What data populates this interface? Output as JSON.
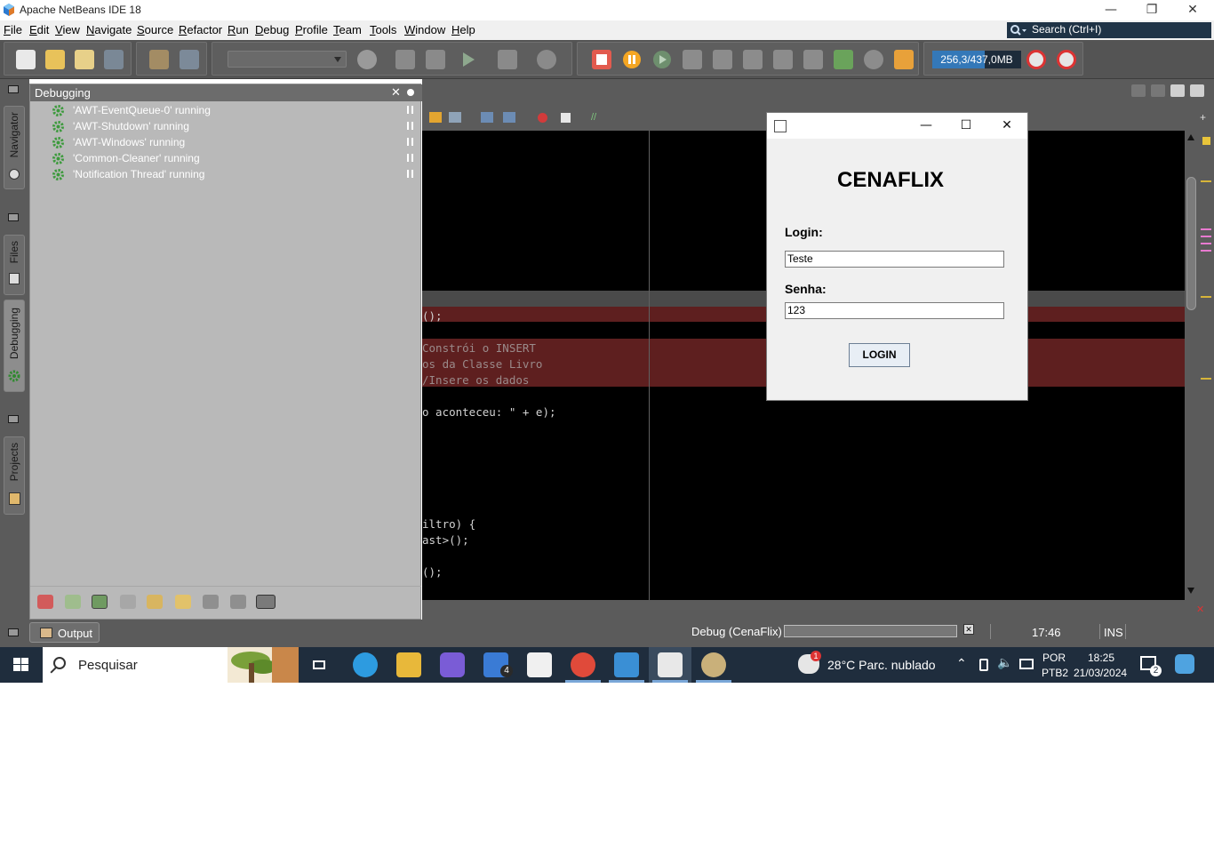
{
  "window": {
    "title": "Apache NetBeans IDE 18"
  },
  "menu": {
    "items": [
      "File",
      "Edit",
      "View",
      "Navigate",
      "Source",
      "Refactor",
      "Run",
      "Debug",
      "Profile",
      "Team",
      "Tools",
      "Window",
      "Help"
    ]
  },
  "search": {
    "placeholder": "Search (Ctrl+I)"
  },
  "toolbar": {
    "memory_label": "256,3/437,0MB",
    "memory_fraction": 0.586
  },
  "sidebar": {
    "tabs": [
      "Navigator",
      "Files",
      "Debugging",
      "Projects"
    ]
  },
  "debug_panel": {
    "title": "Debugging",
    "threads": [
      "'AWT-EventQueue-0' running",
      "'AWT-Shutdown' running",
      "'AWT-Windows' running",
      "'Common-Cleaner' running",
      "'Notification Thread' running"
    ]
  },
  "editor": {
    "lines": [
      "();",
      "Constrói o INSERT",
      "os da Classe Livro",
      "/Insere os dados",
      "o aconteceu: \" + e);",
      "iltro) {",
      "ast>();",
      "();"
    ]
  },
  "statusbar": {
    "output_label": "Output",
    "debug_label": "Debug (CenaFlix)",
    "position": "17:46",
    "mode": "INS"
  },
  "dialog": {
    "title": "CENAFLIX",
    "login_label": "Login:",
    "login_value": "Teste",
    "password_label": "Senha:",
    "password_value": "123",
    "button_label": "LOGIN"
  },
  "taskbar": {
    "search_placeholder": "Pesquisar",
    "mail_badge": "4",
    "weather": "28°C  Parc. nublado",
    "weather_badge": "1",
    "lang_top": "POR",
    "lang_bottom": "PTB2",
    "time": "18:25",
    "date": "21/03/2024",
    "notifications": "2"
  }
}
